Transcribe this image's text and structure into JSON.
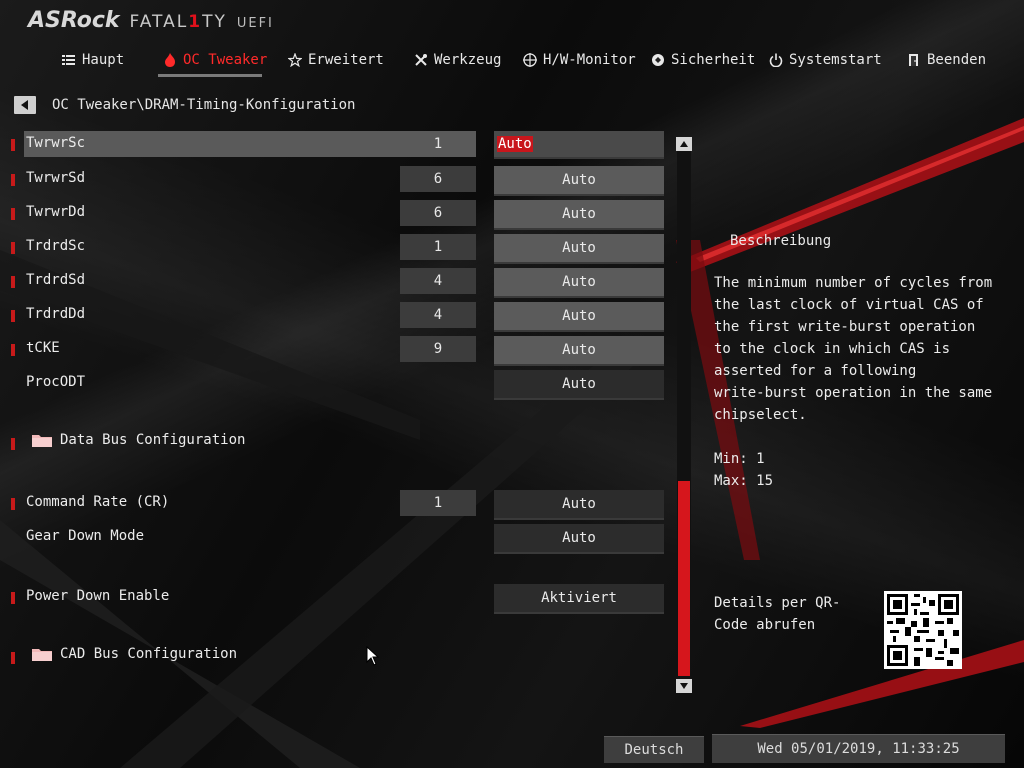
{
  "brand": {
    "asrock": "ASRock",
    "fatal_pre": "FATAL",
    "fatal_one": "1",
    "fatal_post": "TY",
    "uefi": "UEFI"
  },
  "nav": {
    "tabs": [
      {
        "label": "Haupt",
        "icon": "list-icon"
      },
      {
        "label": "OC Tweaker",
        "icon": "flame-icon",
        "active": true
      },
      {
        "label": "Erweitert",
        "icon": "star-icon"
      },
      {
        "label": "Werkzeug",
        "icon": "tools-icon"
      },
      {
        "label": "H/W-Monitor",
        "icon": "crosshair-icon"
      },
      {
        "label": "Sicherheit",
        "icon": "shield-icon"
      },
      {
        "label": "Systemstart",
        "icon": "power-icon"
      },
      {
        "label": "Beenden",
        "icon": "exit-door-icon"
      }
    ]
  },
  "breadcrumb": "OC Tweaker\\DRAM-Timing-Konfiguration",
  "settings": [
    {
      "label": "TwrwrSc",
      "value": "1",
      "option": "Auto"
    },
    {
      "label": "TwrwrSd",
      "value": "6",
      "option": "Auto"
    },
    {
      "label": "TwrwrDd",
      "value": "6",
      "option": "Auto"
    },
    {
      "label": "TrdrdSc",
      "value": "1",
      "option": "Auto"
    },
    {
      "label": "TrdrdSd",
      "value": "4",
      "option": "Auto"
    },
    {
      "label": "TrdrdDd",
      "value": "4",
      "option": "Auto"
    },
    {
      "label": "tCKE",
      "value": "9",
      "option": "Auto"
    },
    {
      "label": "ProcODT",
      "value": "",
      "option": "Auto"
    },
    {
      "label": "Data Bus Configuration",
      "type": "submenu"
    },
    {
      "label": "Command Rate (CR)",
      "value": "1",
      "option": "Auto"
    },
    {
      "label": "Gear Down Mode",
      "value": "",
      "option": "Auto"
    },
    {
      "label": "Power Down Enable",
      "value": "",
      "option": "Aktiviert"
    },
    {
      "label": "CAD Bus Configuration",
      "type": "submenu"
    }
  ],
  "description": {
    "title": "Beschreibung",
    "text": "The minimum number of cycles from\nthe last clock of virtual CAS of\nthe first write-burst operation\nto the clock in which CAS is\nasserted for a following\nwrite-burst operation in the same\nchipselect.",
    "min": "Min: 1",
    "max": "Max: 15",
    "qr_label": "Details per QR-Code abrufen"
  },
  "footer": {
    "language": "Deutsch",
    "datetime": "Wed 05/01/2019, 11:33:25"
  },
  "colors": {
    "accent": "#e0101b",
    "active_tab": "#ff2a2a",
    "button": "#5b5b5b",
    "value_box": "#3c3c3c"
  }
}
